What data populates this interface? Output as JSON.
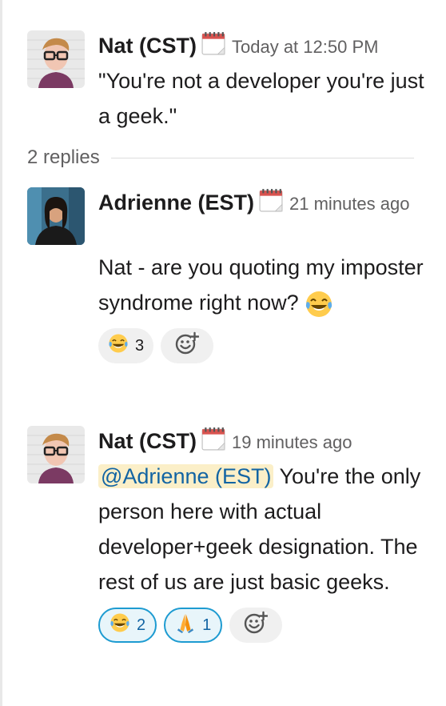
{
  "messages": [
    {
      "author": "Nat (CST)",
      "status_icon": "calendar-icon",
      "time": "Today at 12:50 PM",
      "text": "\"You're not a developer you're just a geek.\""
    },
    {
      "author": "Adrienne (EST)",
      "status_icon": "calendar-icon",
      "time": "21 minutes ago",
      "text": "Nat - are you quoting my imposter syndrome right now?",
      "trailing_emoji": "joy-emoji",
      "reactions": [
        {
          "emoji": "joy-emoji",
          "count": "3",
          "own": false
        }
      ]
    },
    {
      "author": "Nat (CST)",
      "status_icon": "calendar-icon",
      "time": "19 minutes ago",
      "mention": "@Adrienne (EST)",
      "text": " You're the only person here with actual developer+geek designation. The rest of us are just basic geeks.",
      "reactions": [
        {
          "emoji": "joy-emoji",
          "count": "2",
          "own": true
        },
        {
          "emoji": "pray-emoji",
          "count": "1",
          "own": true
        }
      ]
    }
  ],
  "thread": {
    "replies_label": "2 replies"
  },
  "colors": {
    "link": "#1264a3",
    "mention_bg": "#fbefc8",
    "own_reaction_border": "#1d9bd1"
  }
}
